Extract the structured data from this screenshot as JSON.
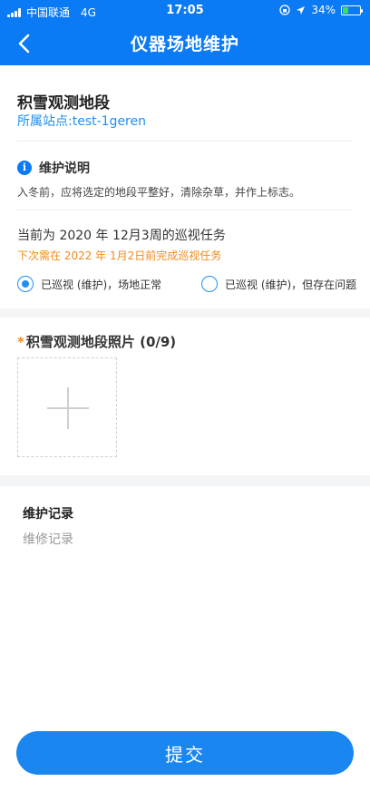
{
  "status_bar": {
    "carrier": "中国联通",
    "network": "4G",
    "time": "17:05",
    "battery_text": "34%",
    "battery_level": 0.34
  },
  "header": {
    "title": "仪器场地维护",
    "back_icon": "chevron-left-icon"
  },
  "station": {
    "name": "积雪观测地段",
    "site": "所属站点:test-1geren"
  },
  "maintenance_note": {
    "title": "维护说明",
    "text": "入冬前，应将选定的地段平整好，清除杂草，并作上标志。"
  },
  "task": {
    "current": "当前为 2020 年 12月3周的巡视任务",
    "next": "下次需在 2022 年 1月2日前完成巡视任务"
  },
  "status_options": [
    {
      "label": "已巡视 (维护)，场地正常",
      "selected": true
    },
    {
      "label": "已巡视 (维护)，但存在问题",
      "selected": false
    }
  ],
  "photos": {
    "required_mark": "*",
    "title": "积雪观测地段照片 (0/9)"
  },
  "record": {
    "label": "维护记录",
    "placeholder": "维修记录"
  },
  "submit_label": "提交",
  "colors": {
    "primary": "#0a7af5",
    "link": "#1f8ff2",
    "warning": "#f08a1c"
  }
}
